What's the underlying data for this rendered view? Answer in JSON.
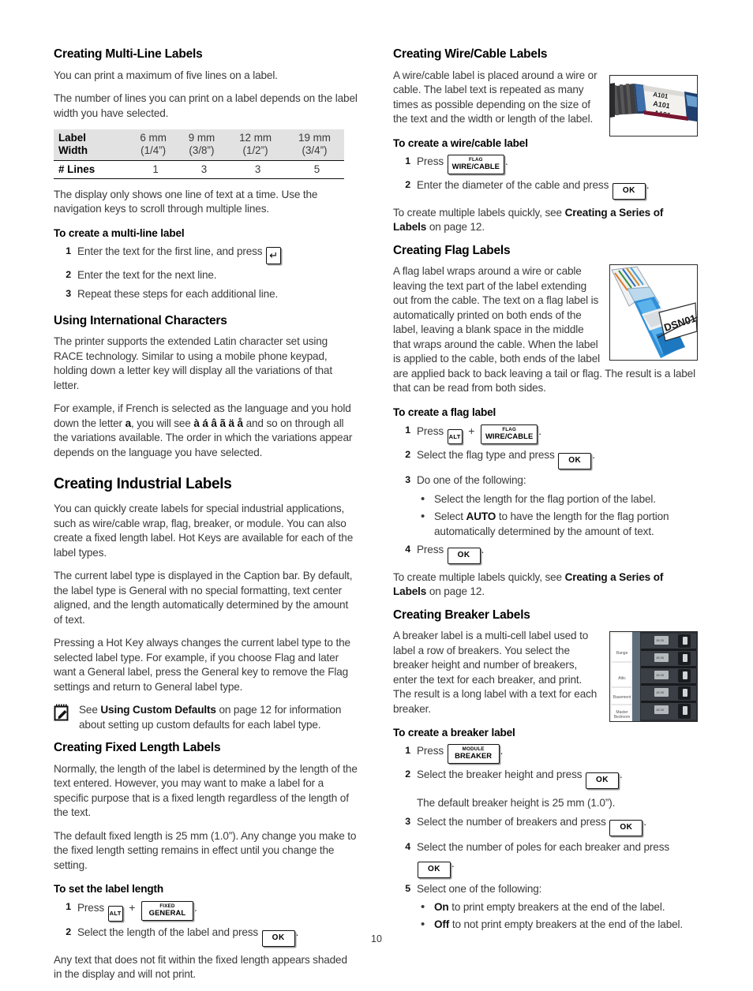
{
  "page": {
    "number": "10"
  },
  "left": {
    "s1": {
      "heading": "Creating Multi-Line Labels",
      "p1": "You can print a maximum of five lines on a label.",
      "p2": "The number of lines you can print on a label depends on the label width you have selected.",
      "table": {
        "row_header_line1": "Label",
        "row_header_line2": "Width",
        "columns": [
          {
            "mm": "6 mm",
            "inch": "(1/4”)"
          },
          {
            "mm": "9 mm",
            "inch": "(3/8”)"
          },
          {
            "mm": "12 mm",
            "inch": "(1/2”)"
          },
          {
            "mm": "19 mm",
            "inch": "(3/4”)"
          }
        ],
        "lines_label": "# Lines",
        "lines_values": [
          "1",
          "3",
          "3",
          "5"
        ]
      },
      "p3": "The display only shows one line of text at a time. Use the navigation keys to scroll through multiple lines.",
      "task": "To create a multi-line label",
      "step1_pre": "Enter the text for the first line, and press",
      "step1_key": "↵",
      "step2": "Enter the text for the next line.",
      "step3": "Repeat these steps for each additional line."
    },
    "s2": {
      "heading": "Using International Characters",
      "p1": "The printer supports the extended Latin character set using RACE technology. Similar to using a mobile phone keypad, holding down a letter key will display all the variations of that letter.",
      "p2_a": "For example, if French is selected as the language and you hold down the letter",
      "p2_letter": "a",
      "p2_b": ", you will see",
      "p2_accents": "à á â ã ä å",
      "p2_c": "and so on through all the variations available. The order in which the variations appear depends on the language you have selected."
    },
    "s3": {
      "heading": "Creating Industrial Labels",
      "p1": "You can quickly create labels for special industrial applications, such as wire/cable wrap, flag, breaker, or module. You can also create a fixed length label. Hot Keys are available for each of the label types.",
      "p2": "The current label type is displayed in the Caption bar. By default, the label type is General with no special formatting, text center aligned, and the length automatically determined by the amount of text.",
      "p3": "Pressing a Hot Key always changes the current label type to the selected label type. For example, if you choose Flag and later want a General label, press the General key to remove the Flag settings and return to General label type.",
      "note_pre": "See",
      "note_bold": "Using Custom Defaults",
      "note_post": "on page 12 for information about setting up custom defaults for each label type."
    },
    "s4": {
      "heading": "Creating Fixed Length Labels",
      "p1": "Normally, the length of the label is determined by the length of the text entered. However, you may want to make a label for a specific purpose that is a fixed length regardless of the length of the text.",
      "p2": "The default fixed length is 25 mm (1.0”). Any change you make to the fixed length setting remains in effect until you change the setting.",
      "task": "To set the label length",
      "step1_pre": "Press",
      "step1_key_alt": "ALT",
      "step1_plus": "+",
      "step1_key_top": "FIXED",
      "step1_key_main": "GENERAL",
      "step2_pre": "Select the length of the label and press",
      "step2_key": "OK",
      "p3": "Any text that does not fit within the fixed length appears shaded in the display and will not print."
    }
  },
  "right": {
    "s1": {
      "heading": "Creating Wire/Cable Labels",
      "p1": "A wire/cable label is placed around a wire or cable. The label text is repeated as many times as possible depending on the size of the text and the width or length of the label.",
      "task": "To create a wire/cable label",
      "step1_pre": "Press",
      "step1_key_top": "FLAG",
      "step1_key_main": "WIRE/CABLE",
      "step2_pre": "Enter the diameter of the cable and press",
      "step2_key": "OK",
      "xref_pre": "To create multiple labels quickly, see",
      "xref_bold": "Creating a Series of Labels",
      "xref_post": "on page 12.",
      "figure": {
        "name": "wire-cable-photo",
        "label_text": "A101"
      }
    },
    "s2": {
      "heading": "Creating Flag Labels",
      "p1": "A flag label wraps around a wire or cable leaving the text part of the label extending out from the cable. The text on a flag label is automatically printed on both ends of the label, leaving a blank space in the middle that wraps around the cable. When the label is applied to the cable, both ends of the label are applied back to back leaving a tail or flag. The result is a label that can be read from both sides.",
      "task": "To create a flag label",
      "step1_pre": "Press",
      "step1_key_alt": "ALT",
      "step1_plus": "+",
      "step1_key_top": "FLAG",
      "step1_key_main": "WIRE/CABLE",
      "step2_pre": "Select the flag type and press",
      "step2_key": "OK",
      "step3": "Do one of the following:",
      "bullet1": "Select the length for the flag portion of the label.",
      "bullet2_pre": "Select",
      "bullet2_bold": "AUTO",
      "bullet2_post": "to have the length for the flag portion automatically determined by the amount of text.",
      "step4_pre": "Press",
      "step4_key": "OK",
      "xref_pre": "To create multiple labels quickly, see",
      "xref_bold": "Creating a Series of Labels",
      "xref_post": "on page 12.",
      "figure": {
        "name": "flag-label-photo",
        "label_text": "DSN01"
      }
    },
    "s3": {
      "heading": "Creating Breaker Labels",
      "p1": "A breaker label is a multi-cell label used to label a row of breakers. You select the breaker height and number of breakers, enter the text for each breaker, and print. The result is a long label with a text for each breaker.",
      "task": "To create a breaker label",
      "step1_pre": "Press",
      "step1_key_top": "MODULE",
      "step1_key_main": "BREAKER",
      "step2_pre": "Select the breaker height and press",
      "step2_key": "OK",
      "step2_sub": "The default breaker height is 25 mm (1.0”).",
      "step3_pre": "Select the number of breakers and press",
      "step3_key": "OK",
      "step4_pre": "Select the number of poles for each breaker and press",
      "step4_key": "OK",
      "step5": "Select one of the following:",
      "bullet1_bold": "On",
      "bullet1_post": "to print empty breakers at the end of the label.",
      "bullet2_bold": "Off",
      "bullet2_post": "to not print empty breakers at the end of the label.",
      "figure": {
        "name": "breaker-panel-photo",
        "breaker_labels": [
          "Range",
          "Attic",
          "Basement",
          "Master Bedroom"
        ]
      }
    }
  }
}
